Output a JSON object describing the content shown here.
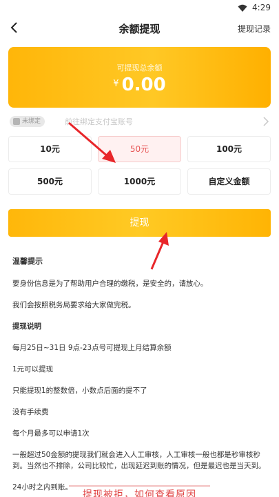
{
  "status_bar": {
    "time": "4:29"
  },
  "nav": {
    "title": "余额提现",
    "record_label": "提现记录"
  },
  "balance": {
    "label": "可提现总余额",
    "currency": "¥",
    "amount": "0.00"
  },
  "bind": {
    "badge": "未绑定",
    "text": "前往绑定支付宝账号"
  },
  "amounts": [
    {
      "label": "10元",
      "selected": false
    },
    {
      "label": "50元",
      "selected": true
    },
    {
      "label": "100元",
      "selected": false
    },
    {
      "label": "500元",
      "selected": false
    },
    {
      "label": "1000元",
      "selected": false
    },
    {
      "label": "自定义金额",
      "selected": false
    }
  ],
  "withdraw_button": "提现",
  "tips": {
    "title": "温馨提示",
    "paragraphs": [
      "要身份信息是为了帮助用户合理的缴税，是安全的，请放心。",
      "我们会按照税务局要求给大家做完税。"
    ],
    "subtitle": "提现说明",
    "notes": [
      "每月25日~31日 9点-23点号可提现上月结算余额",
      "1元可以提现",
      "只能提现1的整数倍，小数点后面的提不了",
      "没有手续费",
      "每个月最多可以申请1次",
      "一般超过50金额的提现我们就会进入人工审核，人工审核一般也都是秒审核秒到。当然也不排除，公司比较忙，出现延迟到账的情况，但是最迟也是当天到。",
      "24小时之内到账。"
    ]
  },
  "bottom_link": "提现被拒，如何查看原因",
  "colors": {
    "accent": "#ffb609",
    "selected_text": "#e75454",
    "annotation_arrow": "#e8262a"
  }
}
